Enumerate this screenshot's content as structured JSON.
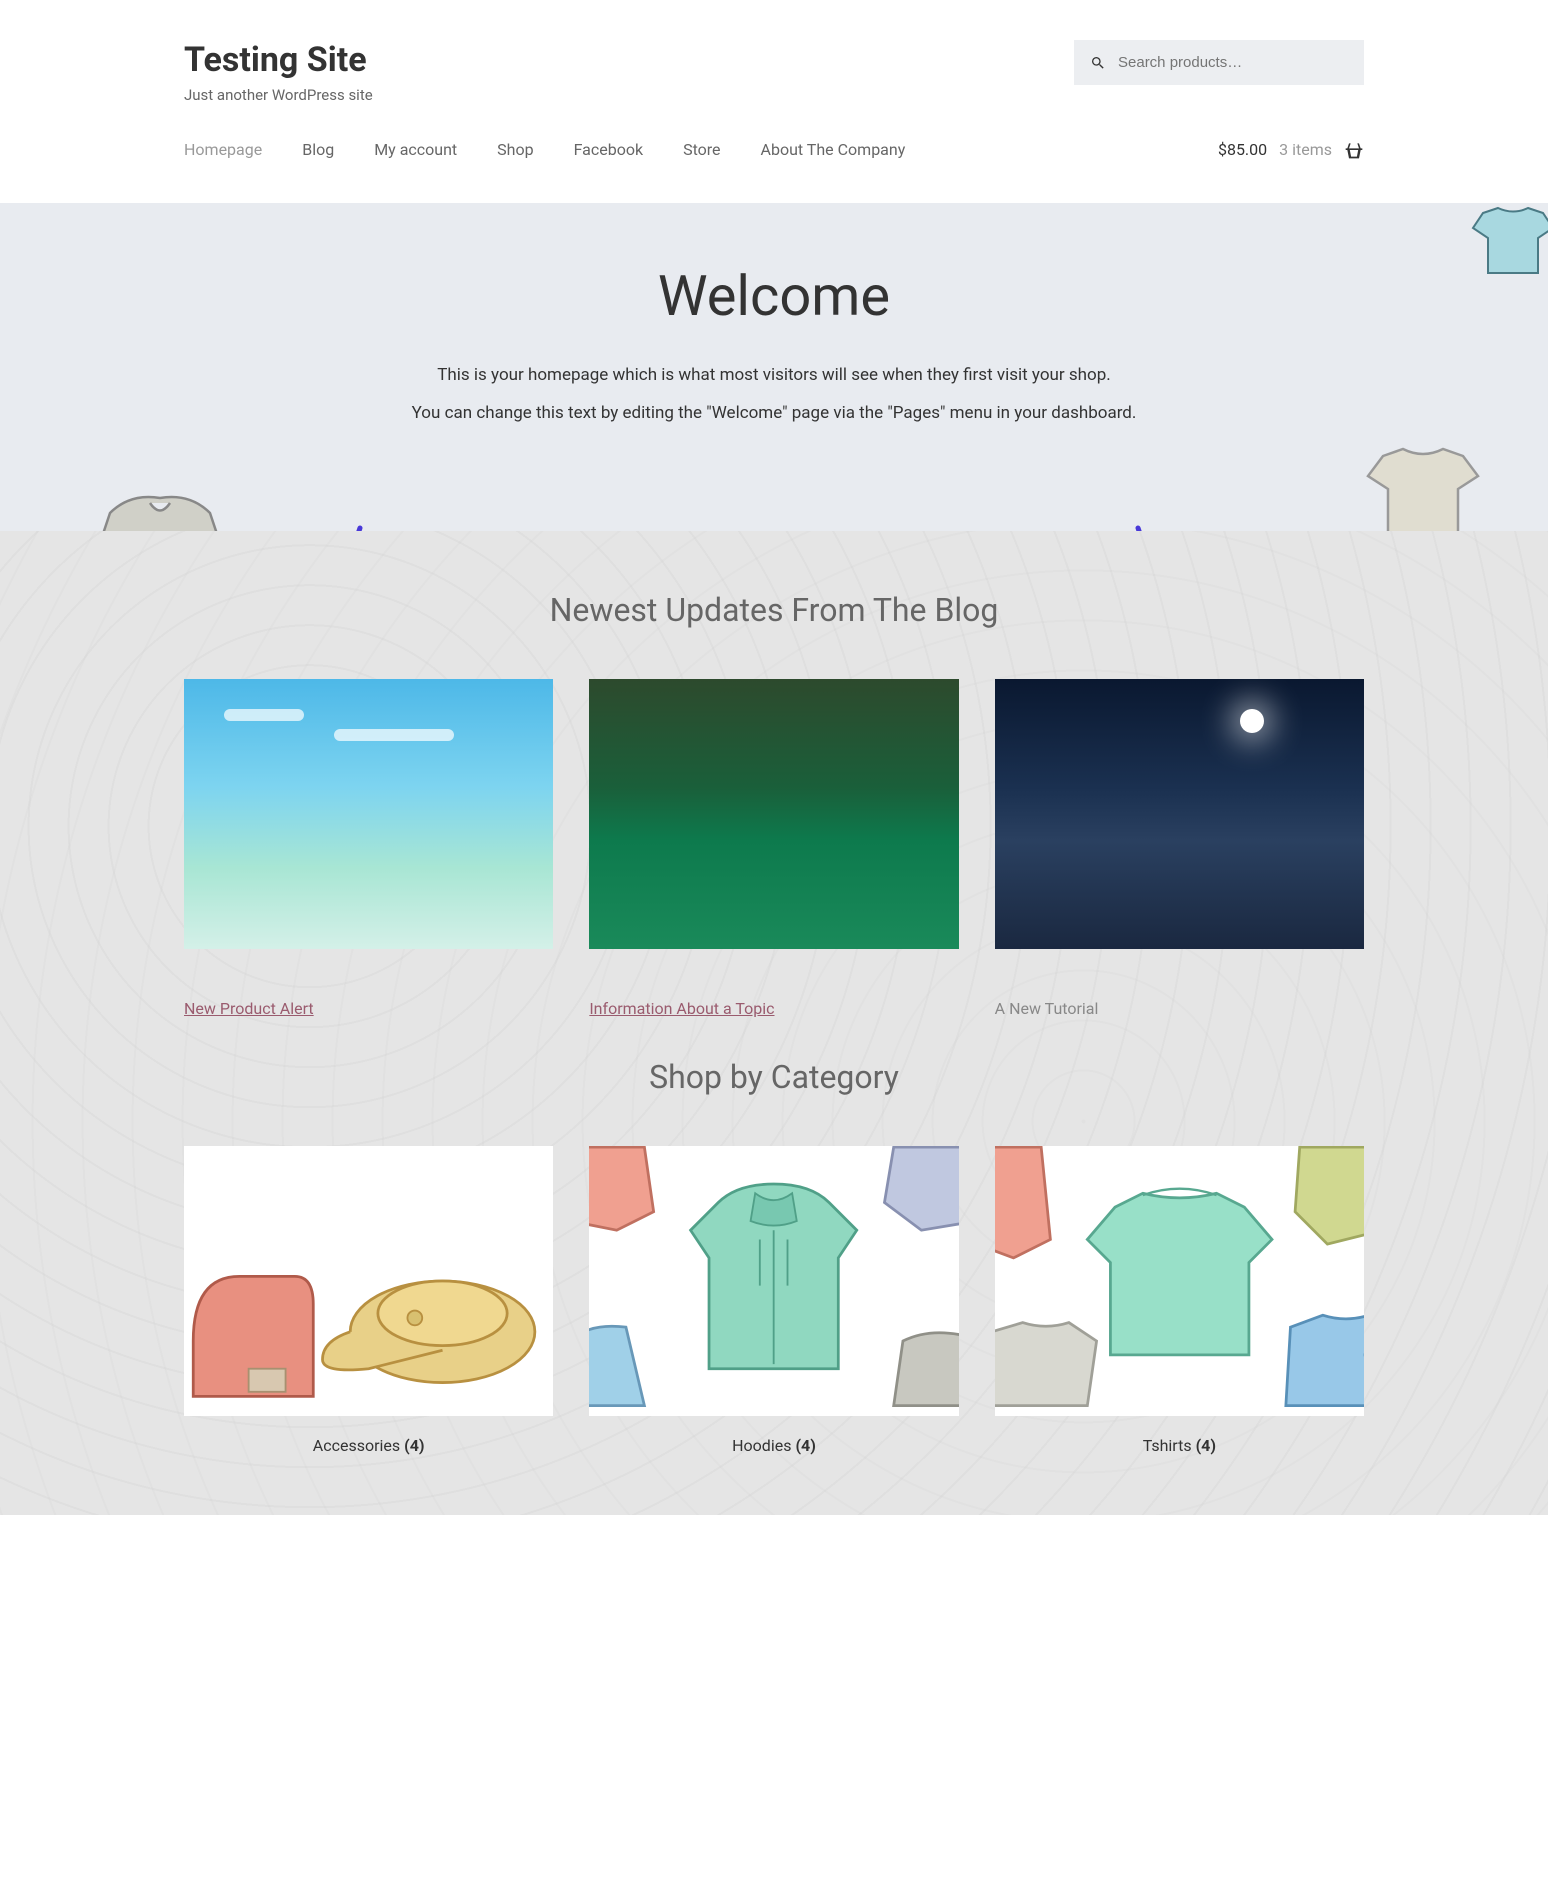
{
  "header": {
    "site_title": "Testing Site",
    "site_tagline": "Just another WordPress site",
    "search_placeholder": "Search products…"
  },
  "nav": {
    "items": [
      {
        "label": "Homepage",
        "active": true
      },
      {
        "label": "Blog",
        "active": false
      },
      {
        "label": "My account",
        "active": false
      },
      {
        "label": "Shop",
        "active": false
      },
      {
        "label": "Facebook",
        "active": false
      },
      {
        "label": "Store",
        "active": false
      },
      {
        "label": "About The Company",
        "active": false
      }
    ],
    "cart_price": "$85.00",
    "cart_count": "3 items"
  },
  "hero": {
    "title": "Welcome",
    "line1": "This is your homepage which is what most visitors will see when they first visit your shop.",
    "line2": "You can change this text by editing the \"Welcome\" page via the \"Pages\" menu in your dashboard."
  },
  "blog_section": {
    "title": "Newest Updates From The Blog",
    "posts": [
      {
        "title": "New Product Alert",
        "linked": true
      },
      {
        "title": "Information About a Topic",
        "linked": true
      },
      {
        "title": "A New Tutorial",
        "linked": false
      }
    ]
  },
  "category_section": {
    "title": "Shop by Category",
    "categories": [
      {
        "name": "Accessories",
        "count": "(4)"
      },
      {
        "name": "Hoodies",
        "count": "(4)"
      },
      {
        "name": "Tshirts",
        "count": "(4)"
      }
    ]
  }
}
